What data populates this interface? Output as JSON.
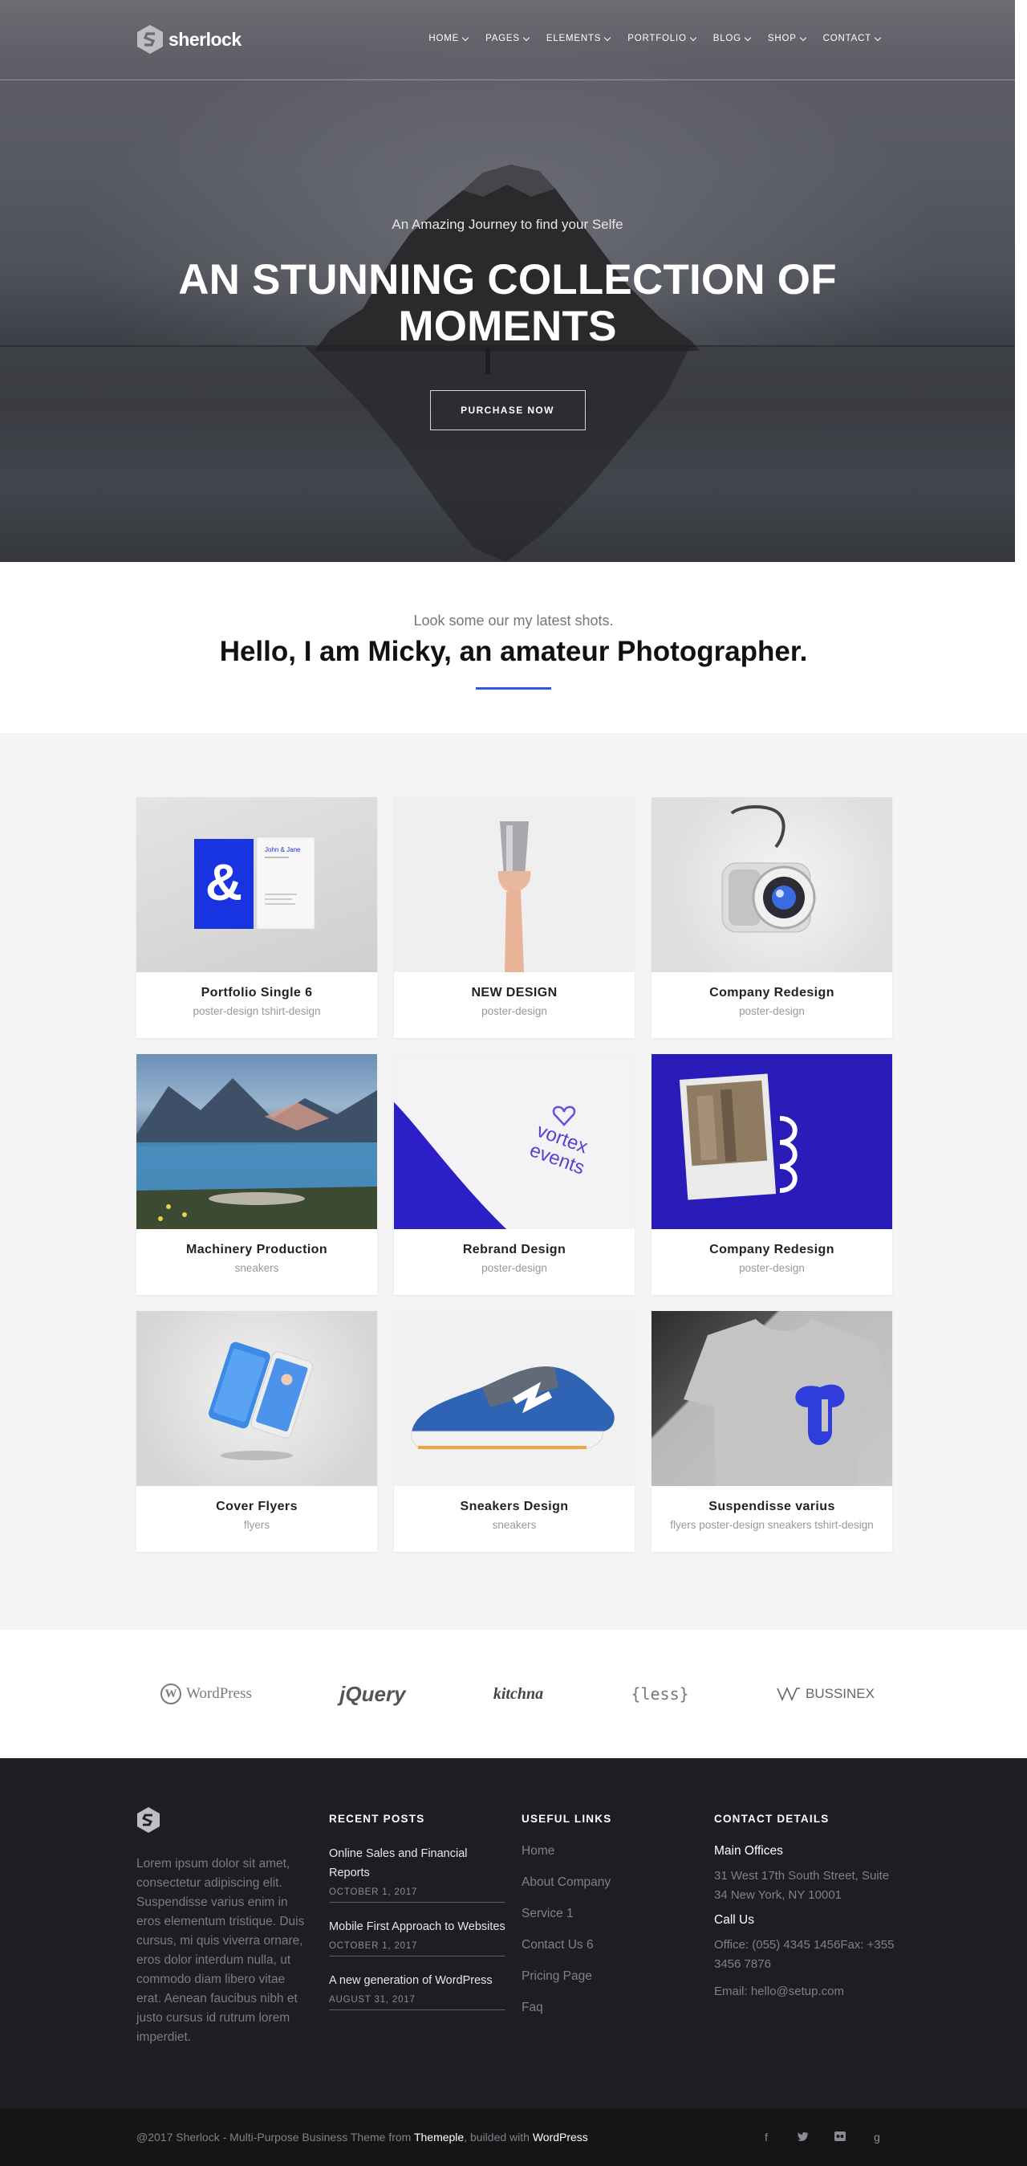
{
  "brand": {
    "name": "sherlock"
  },
  "nav": {
    "items": [
      {
        "label": "HOME"
      },
      {
        "label": "PAGES"
      },
      {
        "label": "ELEMENTS"
      },
      {
        "label": "PORTFOLIO"
      },
      {
        "label": "BLOG"
      },
      {
        "label": "SHOP"
      },
      {
        "label": "CONTACT"
      }
    ]
  },
  "hero": {
    "subtitle": "An Amazing Journey to find your Selfe",
    "title_line1": "AN STUNNING COLLECTION OF",
    "title_line2": "MOMENTS",
    "button": "PURCHASE NOW"
  },
  "intro": {
    "subtitle": "Look some our my latest shots.",
    "title": "Hello, I am Micky, an amateur Photographer.",
    "accent": "#2f58e6"
  },
  "portfolio": {
    "items": [
      {
        "title": "Portfolio Single 6",
        "tags": "poster-design tshirt-design"
      },
      {
        "title": "NEW DESIGN",
        "tags": "poster-design"
      },
      {
        "title": "Company Redesign",
        "tags": "poster-design"
      },
      {
        "title": "Machinery Production",
        "tags": "sneakers"
      },
      {
        "title": "Rebrand Design",
        "tags": "poster-design"
      },
      {
        "title": "Company Redesign",
        "tags": "poster-design"
      },
      {
        "title": "Cover Flyers",
        "tags": "flyers"
      },
      {
        "title": "Sneakers Design",
        "tags": "sneakers"
      },
      {
        "title": "Suspendisse varius",
        "tags": "flyers poster-design sneakers tshirt-design"
      }
    ],
    "mockup_texts": {
      "card_name": "John & Jane",
      "vortex_line1": "vortex",
      "vortex_line2": "events"
    }
  },
  "brands": [
    {
      "name": "WordPress"
    },
    {
      "name": "jQuery"
    },
    {
      "name": "kitchna"
    },
    {
      "name": "{less}"
    },
    {
      "name": "BUSSINEX"
    }
  ],
  "footer": {
    "about": "Lorem ipsum dolor sit amet, consectetur adipiscing elit. Suspendisse varius enim in eros elementum tristique. Duis cursus, mi quis viverra ornare, eros dolor interdum nulla, ut commodo diam libero vitae erat. Aenean faucibus nibh et justo cursus id rutrum lorem imperdiet.",
    "recent_posts_heading": "RECENT POSTS",
    "posts": [
      {
        "title": "Online Sales and Financial Reports",
        "date": "OCTOBER 1, 2017"
      },
      {
        "title": "Mobile First Approach to Websites",
        "date": "OCTOBER 1, 2017"
      },
      {
        "title": "A new generation of WordPress",
        "date": "AUGUST 31, 2017"
      }
    ],
    "useful_links_heading": "USEFUL LINKS",
    "links": [
      "Home",
      "About Company",
      "Service 1",
      "Contact Us 6",
      "Pricing Page",
      "Faq"
    ],
    "contact_heading": "CONTACT DETAILS",
    "main_offices_label": "Main Offices",
    "address": "31 West 17th South Street, Suite 34 New York, NY 10001",
    "call_us_label": "Call Us",
    "phones": "Office: (055) 4345 1456Fax: +355 3456 7876",
    "email": "Email: hello@setup.com"
  },
  "bottom": {
    "copy_prefix": "@2017 Sherlock - Multi-Purpose Business Theme from ",
    "copy_brand": "Themeple",
    "copy_mid": ", builded with ",
    "copy_wp": "WordPress",
    "social": [
      "facebook-icon",
      "twitter-icon",
      "flickr-icon",
      "google-plus-icon"
    ]
  }
}
